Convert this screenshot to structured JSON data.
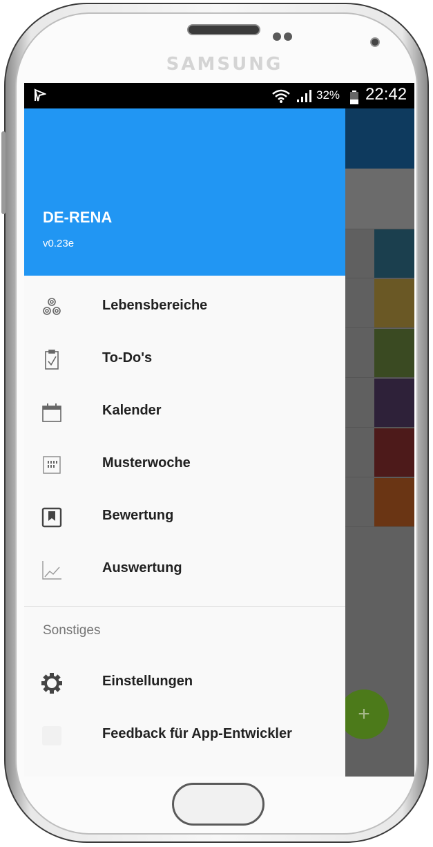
{
  "device": {
    "brand": "SAMSUNG"
  },
  "status_bar": {
    "battery_percent": "32%",
    "time": "22:42"
  },
  "drawer": {
    "app_name": "DE-RENA",
    "version": "v0.23e",
    "items": [
      {
        "label": "Lebensbereiche",
        "icon": "circles-icon"
      },
      {
        "label": "To-Do's",
        "icon": "clipboard-check-icon"
      },
      {
        "label": "Kalender",
        "icon": "calendar-icon"
      },
      {
        "label": "Musterwoche",
        "icon": "week-grid-icon"
      },
      {
        "label": "Bewertung",
        "icon": "bookmark-icon"
      },
      {
        "label": "Auswertung",
        "icon": "line-chart-icon"
      }
    ],
    "section_title": "Sonstiges",
    "other_items": [
      {
        "label": "Einstellungen",
        "icon": "gear-icon"
      },
      {
        "label": "Feedback für App-Entwickler",
        "icon": "feedback-icon"
      }
    ]
  },
  "background_app": {
    "fab_symbol": "+",
    "row_colors": [
      "#1b3f4e",
      "#6a5825",
      "#3a4a22",
      "#2e2139",
      "#4d1a1a",
      "#6a3514"
    ]
  }
}
